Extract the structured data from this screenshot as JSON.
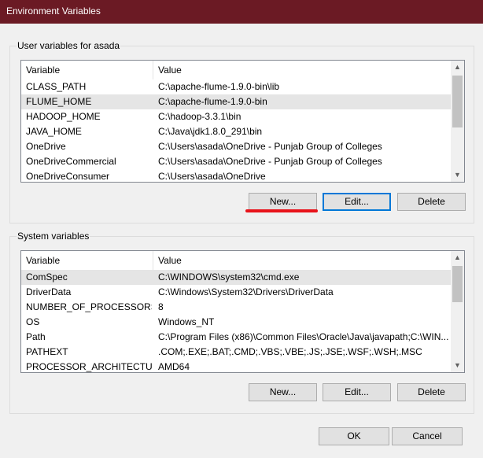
{
  "window": {
    "title": "Environment Variables"
  },
  "user_vars": {
    "label": "User variables for asada",
    "headers": [
      "Variable",
      "Value"
    ],
    "rows": [
      {
        "name": "CLASS_PATH",
        "value": "C:\\apache-flume-1.9.0-bin\\lib"
      },
      {
        "name": "FLUME_HOME",
        "value": "C:\\apache-flume-1.9.0-bin"
      },
      {
        "name": "HADOOP_HOME",
        "value": "C:\\hadoop-3.3.1\\bin"
      },
      {
        "name": "JAVA_HOME",
        "value": "C:\\Java\\jdk1.8.0_291\\bin"
      },
      {
        "name": "OneDrive",
        "value": "C:\\Users\\asada\\OneDrive - Punjab Group of Colleges"
      },
      {
        "name": "OneDriveCommercial",
        "value": "C:\\Users\\asada\\OneDrive - Punjab Group of Colleges"
      },
      {
        "name": "OneDriveConsumer",
        "value": "C:\\Users\\asada\\OneDrive"
      }
    ],
    "buttons": {
      "new": "New...",
      "edit": "Edit...",
      "delete": "Delete"
    }
  },
  "system_vars": {
    "label": "System variables",
    "headers": [
      "Variable",
      "Value"
    ],
    "rows": [
      {
        "name": "ComSpec",
        "value": "C:\\WINDOWS\\system32\\cmd.exe"
      },
      {
        "name": "DriverData",
        "value": "C:\\Windows\\System32\\Drivers\\DriverData"
      },
      {
        "name": "NUMBER_OF_PROCESSORS",
        "value": "8"
      },
      {
        "name": "OS",
        "value": "Windows_NT"
      },
      {
        "name": "Path",
        "value": "C:\\Program Files (x86)\\Common Files\\Oracle\\Java\\javapath;C:\\WIN..."
      },
      {
        "name": "PATHEXT",
        "value": ".COM;.EXE;.BAT;.CMD;.VBS;.VBE;.JS;.JSE;.WSF;.WSH;.MSC"
      },
      {
        "name": "PROCESSOR_ARCHITECTURE",
        "value": "AMD64"
      }
    ],
    "buttons": {
      "new": "New...",
      "edit": "Edit...",
      "delete": "Delete"
    }
  },
  "dialog_buttons": {
    "ok": "OK",
    "cancel": "Cancel"
  },
  "icons": {
    "scroll_up": "▲",
    "scroll_down": "▼"
  },
  "colors": {
    "titlebar": "#6b1a24",
    "selection": "#e5e5e5",
    "highlight": "#e8131a",
    "focus": "#0078d7"
  }
}
